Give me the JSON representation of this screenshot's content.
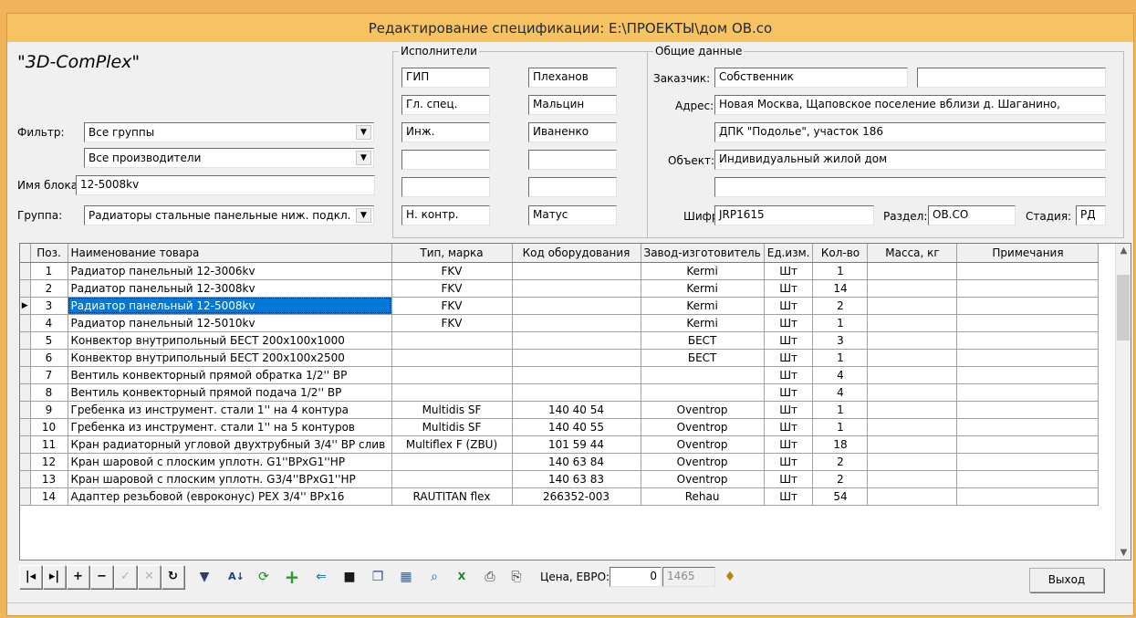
{
  "window": {
    "title": "Редактирование спецификации: E:\\ПРОЕКТЫ\\дом ОВ.co"
  },
  "app": {
    "name": "\"3D-ComPlex\""
  },
  "filter": {
    "filter_label": "Фильтр:",
    "group_filter": "Все группы",
    "maker_filter": "Все производители",
    "block_label": "Имя блока:",
    "block_value": "12-5008kv",
    "group_label": "Группа:",
    "group_value": "Радиаторы стальные панельные ниж. подкл."
  },
  "executors": {
    "title": "Исполнители",
    "rows": [
      {
        "role": "ГИП",
        "name": "Плеханов"
      },
      {
        "role": "Гл. спец.",
        "name": "Мальцин"
      },
      {
        "role": "Инж.",
        "name": "Иваненко"
      },
      {
        "role": "",
        "name": ""
      },
      {
        "role": "",
        "name": ""
      },
      {
        "role": "Н. контр.",
        "name": "Матус"
      }
    ]
  },
  "general": {
    "title": "Общие данные",
    "customer_label": "Заказчик:",
    "customer": "Собственник",
    "customer_extra": "",
    "address_label": "Адрес:",
    "address1": "Новая Москва, Щаповское поселение вблизи д. Шаганино,",
    "address2": "ДПК \"Подолье\", участок 186",
    "object_label": "Объект:",
    "object": "Индивидуальный жилой дом",
    "object2": "",
    "cipher_label": "Шифр:",
    "cipher": "JRP1615",
    "section_label": "Раздел:",
    "section": "ОВ.СО",
    "stage_label": "Стадия:",
    "stage": "РД"
  },
  "table": {
    "columns": [
      "Поз.",
      "Наименование товара",
      "Тип, марка",
      "Код оборудования",
      "Завод-изготовитель",
      "Ед.изм.",
      "Кол-во",
      "Масса, кг",
      "Примечания"
    ],
    "selected_row": 2,
    "rows": [
      [
        "1",
        "Радиатор панельный 12-3006kv",
        "FKV",
        "",
        "Kermi",
        "Шт",
        "1",
        "",
        ""
      ],
      [
        "2",
        "Радиатор панельный 12-3008kv",
        "FKV",
        "",
        "Kermi",
        "Шт",
        "14",
        "",
        ""
      ],
      [
        "3",
        "Радиатор панельный 12-5008kv",
        "FKV",
        "",
        "Kermi",
        "Шт",
        "2",
        "",
        ""
      ],
      [
        "4",
        "Радиатор панельный 12-5010kv",
        "FKV",
        "",
        "Kermi",
        "Шт",
        "1",
        "",
        ""
      ],
      [
        "5",
        "Конвектор внутрипольный БЕСТ 200х100х1000",
        "",
        "",
        "БЕСТ",
        "Шт",
        "3",
        "",
        ""
      ],
      [
        "6",
        "Конвектор внутрипольный БЕСТ 200х100х2500",
        "",
        "",
        "БЕСТ",
        "Шт",
        "1",
        "",
        ""
      ],
      [
        "7",
        "Вентиль конвекторный прямой обратка 1/2'' ВР",
        "",
        "",
        "",
        "Шт",
        "4",
        "",
        ""
      ],
      [
        "8",
        "Вентиль конвекторный прямой подача 1/2'' ВР",
        "",
        "",
        "",
        "Шт",
        "4",
        "",
        ""
      ],
      [
        "9",
        "Гребенка из инструмент. стали 1'' на 4 контура",
        "Multidis SF",
        "140 40 54",
        "Oventrop",
        "Шт",
        "1",
        "",
        ""
      ],
      [
        "10",
        "Гребенка из инструмент. стали 1'' на 5 контуров",
        "Multidis SF",
        "140 40 55",
        "Oventrop",
        "Шт",
        "1",
        "",
        ""
      ],
      [
        "11",
        "Кран радиаторный угловой двухтрубный 3/4'' ВР слив",
        "Multiflex F (ZBU)",
        "101 59 44",
        "Oventrop",
        "Шт",
        "18",
        "",
        ""
      ],
      [
        "12",
        "Кран шаровой с плоским уплотн. G1''ВРхG1''НР",
        "",
        "140 63 84",
        "Oventrop",
        "Шт",
        "2",
        "",
        ""
      ],
      [
        "13",
        "Кран шаровой с плоским уплотн. G3/4''ВРхG1''НР",
        "",
        "140 63 83",
        "Oventrop",
        "Шт",
        "2",
        "",
        ""
      ],
      [
        "14",
        "Адаптер резьбовой (евроконус) PEX 3/4'' ВРх16",
        "RAUTITAN flex",
        "266352-003",
        "Rehau",
        "Шт",
        "54",
        "",
        ""
      ]
    ]
  },
  "toolbar": {
    "price_label": "Цена, ЕВРО:",
    "price_value": "0",
    "price_total": "1465",
    "exit_label": "Выход"
  }
}
